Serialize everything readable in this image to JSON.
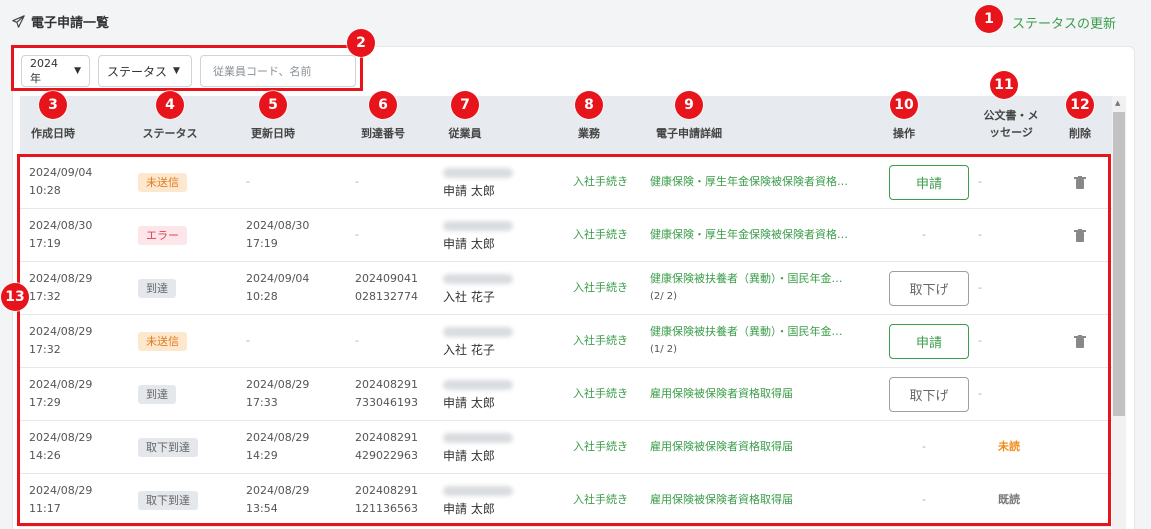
{
  "header": {
    "title": "電子申請一覧",
    "status_update_link": "ステータスの更新"
  },
  "filters": {
    "year": "2024年",
    "status": "ステータス",
    "search_placeholder": "従業員コード、名前"
  },
  "columns": {
    "created": "作成日時",
    "status": "ステータス",
    "updated": "更新日時",
    "arrival_no": "到達番号",
    "employee": "従業員",
    "task": "業務",
    "detail": "電子申請詳細",
    "action": "操作",
    "doc_line1": "公文書・メ",
    "doc_line2": "ッセージ",
    "delete": "削除"
  },
  "rows": [
    {
      "created_date": "2024/09/04",
      "created_time": "10:28",
      "status": "未送信",
      "updated_date": "-",
      "updated_time": "",
      "arrival_1": "-",
      "arrival_2": "",
      "employee": "申請 太郎",
      "task": "入社手続き",
      "detail": "健康保険・厚生年金保険被保険者資格…",
      "detail_sub": "",
      "action": "申請",
      "doc": "-",
      "deletable": true
    },
    {
      "created_date": "2024/08/30",
      "created_time": "17:19",
      "status": "エラー",
      "updated_date": "2024/08/30",
      "updated_time": "17:19",
      "arrival_1": "-",
      "arrival_2": "",
      "employee": "申請 太郎",
      "task": "入社手続き",
      "detail": "健康保険・厚生年金保険被保険者資格…",
      "detail_sub": "",
      "action": "-",
      "doc": "-",
      "deletable": true
    },
    {
      "created_date": "2024/08/29",
      "created_time": "17:32",
      "status": "到達",
      "updated_date": "2024/09/04",
      "updated_time": "10:28",
      "arrival_1": "202409041",
      "arrival_2": "028132774",
      "employee": "入社 花子",
      "task": "入社手続き",
      "detail": "健康保険被扶養者（異動）・国民年金…",
      "detail_sub": "(2/ 2)",
      "action": "取下げ",
      "doc": "-",
      "deletable": false
    },
    {
      "created_date": "2024/08/29",
      "created_time": "17:32",
      "status": "未送信",
      "updated_date": "-",
      "updated_time": "",
      "arrival_1": "-",
      "arrival_2": "",
      "employee": "入社 花子",
      "task": "入社手続き",
      "detail": "健康保険被扶養者（異動）・国民年金…",
      "detail_sub": "(1/ 2)",
      "action": "申請",
      "doc": "-",
      "deletable": true
    },
    {
      "created_date": "2024/08/29",
      "created_time": "17:29",
      "status": "到達",
      "updated_date": "2024/08/29",
      "updated_time": "17:33",
      "arrival_1": "202408291",
      "arrival_2": "733046193",
      "employee": "申請 太郎",
      "task": "入社手続き",
      "detail": "雇用保険被保険者資格取得届",
      "detail_sub": "",
      "action": "取下げ",
      "doc": "-",
      "deletable": false
    },
    {
      "created_date": "2024/08/29",
      "created_time": "14:26",
      "status": "取下到達",
      "updated_date": "2024/08/29",
      "updated_time": "14:29",
      "arrival_1": "202408291",
      "arrival_2": "429022963",
      "employee": "申請 太郎",
      "task": "入社手続き",
      "detail": "雇用保険被保険者資格取得届",
      "detail_sub": "",
      "action": "-",
      "doc": "未読",
      "deletable": false
    },
    {
      "created_date": "2024/08/29",
      "created_time": "11:17",
      "status": "取下到達",
      "updated_date": "2024/08/29",
      "updated_time": "13:54",
      "arrival_1": "202408291",
      "arrival_2": "121136563",
      "employee": "申請 太郎",
      "task": "入社手続き",
      "detail": "雇用保険被保険者資格取得届",
      "detail_sub": "",
      "action": "-",
      "doc": "既読",
      "deletable": false
    }
  ],
  "callouts": [
    "1",
    "2",
    "3",
    "4",
    "5",
    "6",
    "7",
    "8",
    "9",
    "10",
    "11",
    "12",
    "13"
  ],
  "colors": {
    "accent_green": "#3a9d4a",
    "callout_red": "#e8141c"
  },
  "icons": {
    "title": "paper-plane-icon",
    "delete": "trash-icon",
    "dropdown": "caret-down-icon"
  }
}
